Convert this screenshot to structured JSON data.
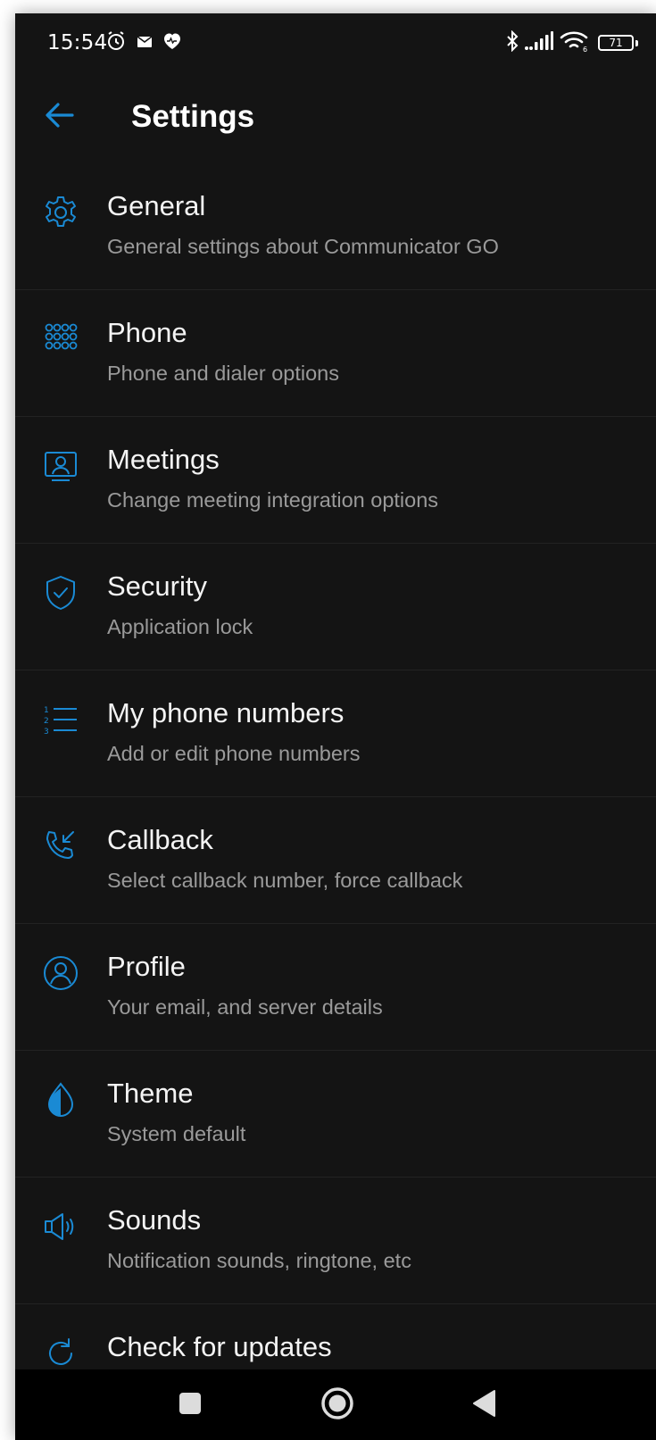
{
  "status_bar": {
    "time": "15:54",
    "battery_level": "71",
    "icons_left": [
      "alarm-icon",
      "mail-icon",
      "heart-icon"
    ],
    "icons_right": [
      "bluetooth-icon",
      "signal-icon",
      "wifi-icon",
      "battery-icon"
    ]
  },
  "app_bar": {
    "title": "Settings",
    "back_icon": "arrow-left-icon"
  },
  "colors": {
    "accent": "#1a8ad4",
    "background": "#141414",
    "title_text": "#f4f4f4",
    "subtitle_text": "#9a9a9a",
    "divider": "#232323",
    "nav_bar": "#000000"
  },
  "settings": {
    "items": [
      {
        "icon": "gear-icon",
        "title": "General",
        "subtitle": "General settings about Communicator GO"
      },
      {
        "icon": "dialpad-icon",
        "title": "Phone",
        "subtitle": "Phone and dialer options"
      },
      {
        "icon": "meeting-icon",
        "title": "Meetings",
        "subtitle": "Change meeting integration options"
      },
      {
        "icon": "shield-check-icon",
        "title": "Security",
        "subtitle": "Application lock"
      },
      {
        "icon": "numbered-list-icon",
        "title": "My phone numbers",
        "subtitle": "Add or edit phone numbers"
      },
      {
        "icon": "callback-icon",
        "title": "Callback",
        "subtitle": "Select callback number, force callback"
      },
      {
        "icon": "profile-icon",
        "title": "Profile",
        "subtitle": "Your email, and server details"
      },
      {
        "icon": "theme-drop-icon",
        "title": "Theme",
        "subtitle": "System default"
      },
      {
        "icon": "speaker-icon",
        "title": "Sounds",
        "subtitle": "Notification sounds, ringtone, etc"
      },
      {
        "icon": "refresh-icon",
        "title": "Check for updates",
        "subtitle": ""
      }
    ]
  },
  "nav_bar": {
    "buttons": [
      "recent-apps-icon",
      "home-icon",
      "back-triangle-icon"
    ]
  }
}
